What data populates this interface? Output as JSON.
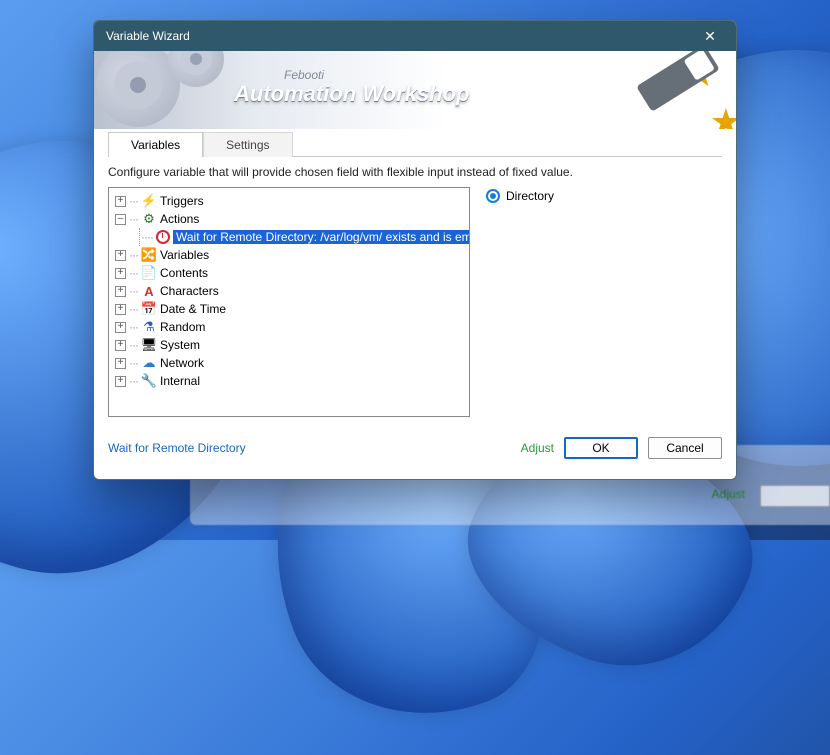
{
  "window": {
    "title": "Variable Wizard"
  },
  "banner": {
    "brand": "Febooti",
    "product": "Automation Workshop"
  },
  "tabs": {
    "active": "Variables",
    "inactive": "Settings"
  },
  "description": "Configure variable that will provide chosen field with flexible input instead of fixed value.",
  "tree": {
    "items": [
      {
        "label": "Triggers",
        "icon": "⚡"
      },
      {
        "label": "Actions",
        "icon": "⚙",
        "expanded": true,
        "children": [
          {
            "label": "Wait for Remote Directory: /var/log/vm/ exists and is empty",
            "selected": true
          }
        ]
      },
      {
        "label": "Variables",
        "icon": "🔀"
      },
      {
        "label": "Contents",
        "icon": "📄"
      },
      {
        "label": "Characters",
        "icon": "A"
      },
      {
        "label": "Date & Time",
        "icon": "📅"
      },
      {
        "label": "Random",
        "icon": "⚗"
      },
      {
        "label": "System",
        "icon": "🖥"
      },
      {
        "label": "Network",
        "icon": "☁"
      },
      {
        "label": "Internal",
        "icon": "🔧"
      }
    ]
  },
  "option": {
    "label": "Directory"
  },
  "footer": {
    "link": "Wait for Remote Directory",
    "adjust": "Adjust",
    "ok": "OK",
    "cancel": "Cancel"
  }
}
